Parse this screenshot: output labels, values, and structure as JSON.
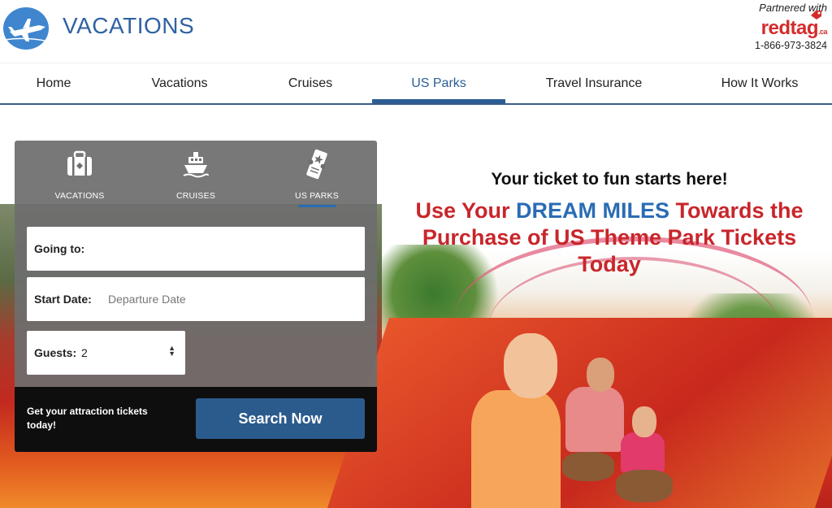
{
  "header": {
    "brand": "VACATIONS",
    "partner_label": "Partnered with",
    "partner_name": "redtag",
    "partner_suffix": ".ca",
    "phone": "1-866-973-3824"
  },
  "nav": {
    "items": [
      {
        "label": "Home"
      },
      {
        "label": "Vacations"
      },
      {
        "label": "Cruises"
      },
      {
        "label": "US Parks",
        "active": true
      },
      {
        "label": "Travel Insurance"
      },
      {
        "label": "How It Works"
      }
    ]
  },
  "search_panel": {
    "tabs": [
      {
        "label": "VACATIONS",
        "icon": "suitcase-icon"
      },
      {
        "label": "CRUISES",
        "icon": "cruise-ship-icon"
      },
      {
        "label": "US PARKS",
        "icon": "ticket-icon",
        "active": true
      }
    ],
    "going_to_label": "Going to:",
    "start_date_label": "Start Date:",
    "start_date_placeholder": "Departure Date",
    "guests_label": "Guests:",
    "guests_value": "2",
    "cta_text": "Get your attraction tickets today!",
    "search_button": "Search Now"
  },
  "promo": {
    "tagline": "Your ticket to fun starts here!",
    "headline_part1": "Use Your ",
    "headline_highlight": "DREAM MILES",
    "headline_part2": " Towards the Purchase of US Theme Park Tickets Today"
  },
  "colors": {
    "brand_blue": "#2f62a3",
    "nav_active": "#2b5e94",
    "redtag_red": "#d42c2c",
    "headline_red": "#c8262b",
    "search_button": "#2b5b8d"
  }
}
